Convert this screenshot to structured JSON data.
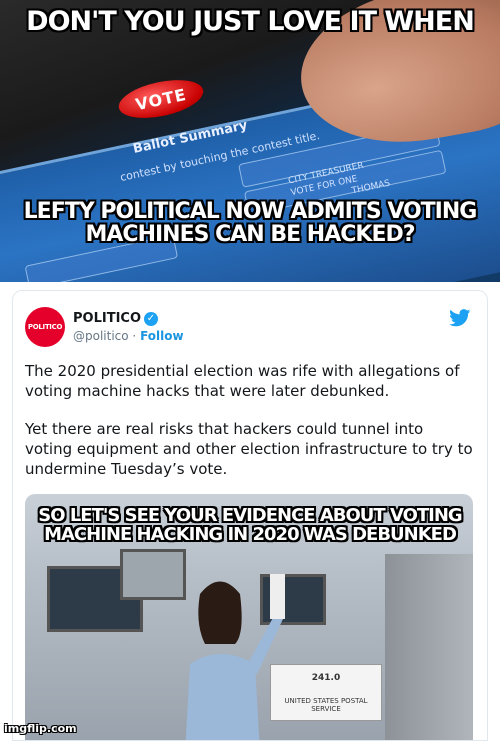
{
  "meme": {
    "top_caption": "DON'T YOU JUST LOVE IT WHEN",
    "middle_caption": "LEFTY POLITICAL NOW ADMITS VOTING MACHINES CAN BE HACKED?",
    "bottom_caption": "SO LET'S SEE YOUR EVIDENCE ABOUT VOTING MACHINE HACKING IN 2020 WAS DEBUNKED",
    "watermark": "imgflip.com"
  },
  "photo": {
    "vote_button": "VOTE",
    "ballot_title": "Ballot Summary",
    "ballot_sub": "contest by touching the contest title.",
    "city_lines": [
      "CITY TREASURER",
      "VOTE FOR ONE",
      "THOMAS"
    ]
  },
  "tweet": {
    "avatar_text": "POLITICO",
    "name": "POLITICO",
    "handle": "@politico",
    "separator": " · ",
    "follow": "Follow",
    "paragraph1": "The 2020 presidential election was rife with allegations of voting machine hacks that were later debunked.",
    "paragraph2": "Yet there are real risks that hackers could tunnel into voting equipment and other election infrastructure to try to undermine Tuesday’s vote.",
    "box_label": "UNITED STATES POSTAL SERVICE",
    "box_number": "241.0",
    "colors": {
      "brand_red": "#e4002b",
      "twitter_blue": "#1da1f2"
    }
  }
}
